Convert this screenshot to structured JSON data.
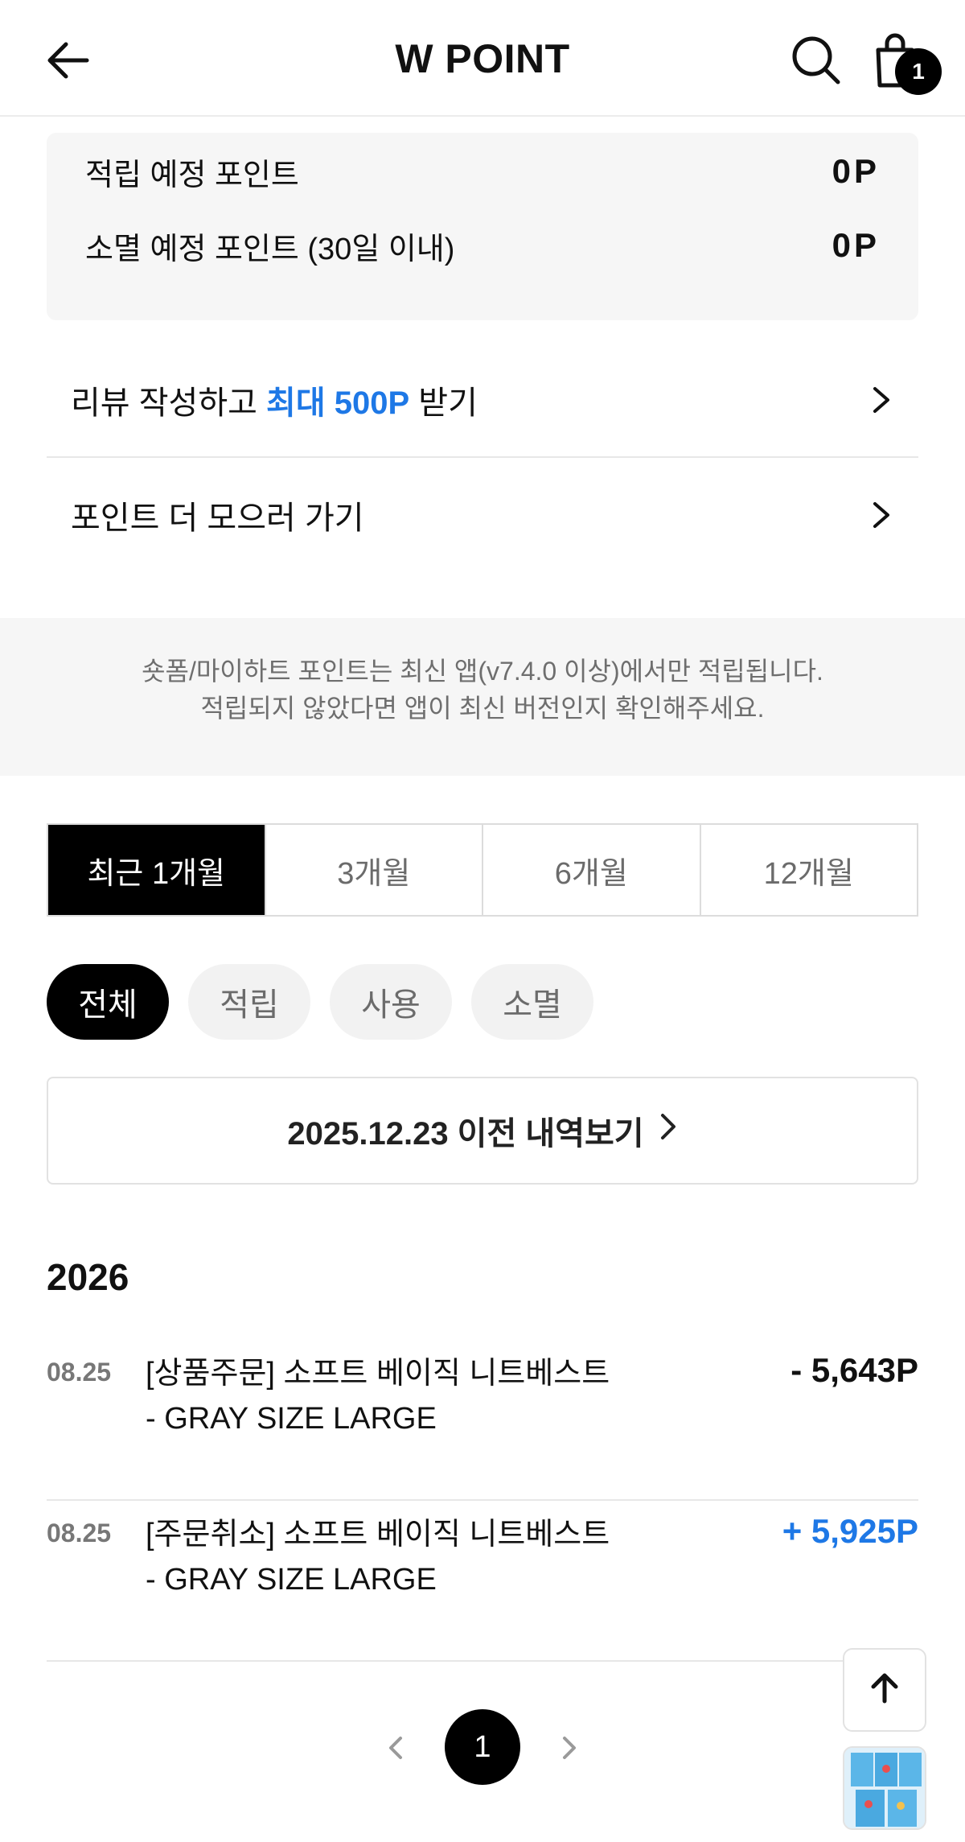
{
  "header": {
    "title": "W POINT",
    "cart_count": "1",
    "icons": {
      "back": "arrow-left-icon",
      "search": "search-icon",
      "cart": "shopping-bag-icon"
    }
  },
  "summary": {
    "pending_label": "적립 예정 포인트",
    "pending_value": "0P",
    "expiring_label": "소멸 예정 포인트 (30일 이내)",
    "expiring_value": "0P"
  },
  "links": {
    "review_prefix": "리뷰 작성하고 ",
    "review_accent": "최대 500P",
    "review_suffix": " 받기",
    "collect_more": "포인트 더 모으러 가기"
  },
  "notice": {
    "line1": "숏폼/마이하트 포인트는 최신 앱(v7.4.0 이상)에서만 적립됩니다.",
    "line2": "적립되지 않았다면 앱이 최신 버전인지 확인해주세요."
  },
  "period_tabs": [
    "최근 1개월",
    "3개월",
    "6개월",
    "12개월"
  ],
  "filter_chips": [
    "전체",
    "적립",
    "사용",
    "소멸"
  ],
  "history_button": "2025.12.23 이전 내역보기",
  "year": "2026",
  "entries": [
    {
      "date": "08.25",
      "description": "[상품주문] 소프트 베이직 니트베스트 - GRAY SIZE LARGE",
      "amount": "- 5,643P",
      "type": "minus"
    },
    {
      "date": "08.25",
      "description": "[주문취소] 소프트 베이직 니트베스트 - GRAY SIZE LARGE",
      "amount": "+ 5,925P",
      "type": "plus"
    }
  ],
  "pagination": {
    "current": "1"
  },
  "colors": {
    "accent": "#1e78e6",
    "active": "#000000",
    "panel": "#f6f6f6"
  }
}
